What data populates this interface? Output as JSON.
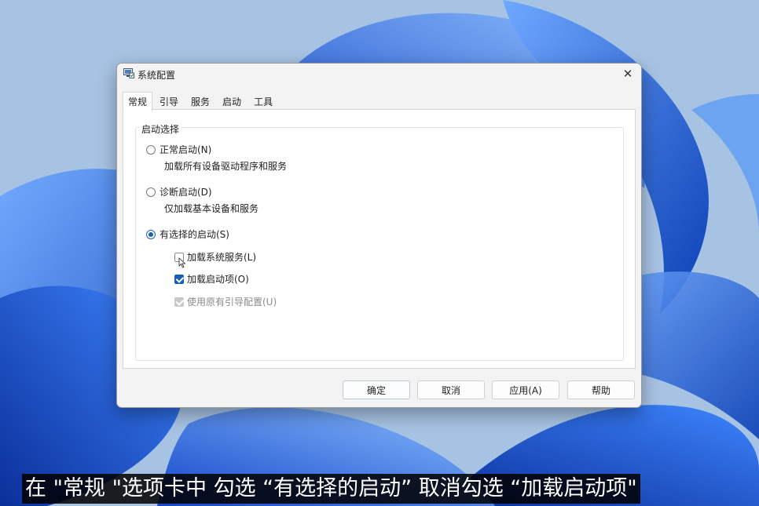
{
  "window": {
    "title": "系统配置",
    "close_glyph": "✕"
  },
  "tabs": [
    {
      "label": "常规",
      "active": true
    },
    {
      "label": "引导",
      "active": false
    },
    {
      "label": "服务",
      "active": false
    },
    {
      "label": "启动",
      "active": false
    },
    {
      "label": "工具",
      "active": false
    }
  ],
  "startup_selection": {
    "group_label": "启动选择",
    "normal": {
      "label": "正常启动(N)",
      "description": "加载所有设备驱动程序和服务",
      "selected": false
    },
    "diagnostic": {
      "label": "诊断启动(D)",
      "description": "仅加载基本设备和服务",
      "selected": false
    },
    "selective": {
      "label": "有选择的启动(S)",
      "selected": true,
      "options": {
        "load_system_services": {
          "label": "加载系统服务(L)",
          "checked": false,
          "enabled": true
        },
        "load_startup_items": {
          "label": "加载启动项(O)",
          "checked": true,
          "enabled": true
        },
        "use_original_boot_config": {
          "label": "使用原有引导配置(U)",
          "checked": true,
          "enabled": false
        }
      }
    }
  },
  "buttons": {
    "ok": "确定",
    "cancel": "取消",
    "apply": "应用(A)",
    "help": "帮助"
  },
  "caption": "在 \"常规 \"选项卡中 勾选 “有选择的启动” 取消勾选 “加载启动项\"",
  "colors": {
    "accent": "#1a5fb4",
    "dialog_bg": "#f3f3f3",
    "panel_bg": "#ffffff"
  },
  "icons": [
    "msconfig-app-icon",
    "close-icon",
    "mouse-cursor-icon"
  ]
}
